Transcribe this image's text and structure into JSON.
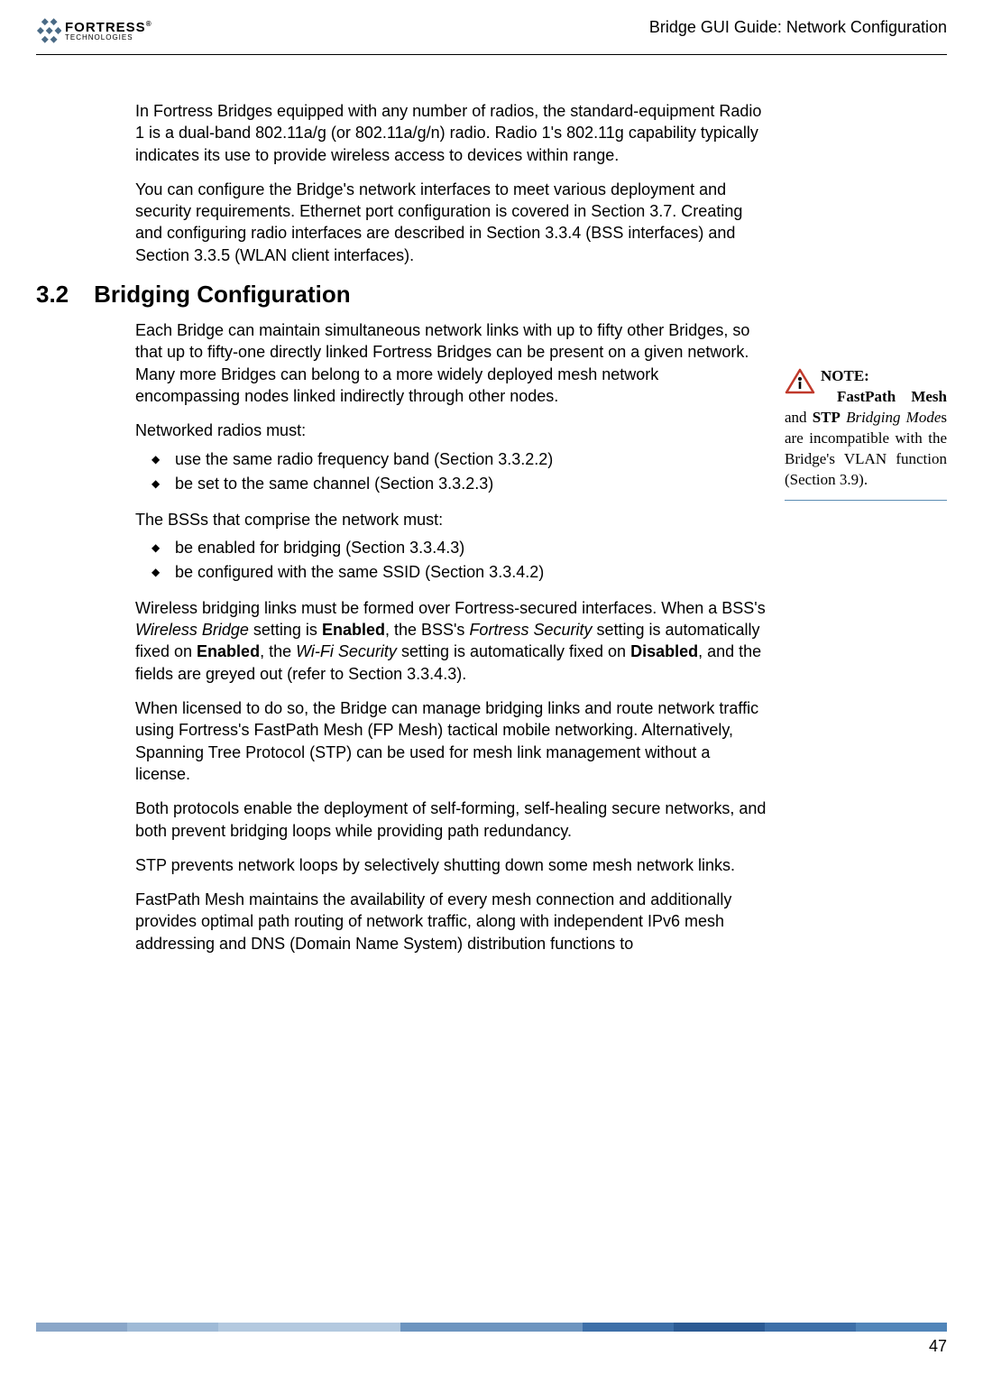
{
  "header": {
    "logo_main": "FORTRESS",
    "logo_sub": "TECHNOLOGIES",
    "title": "Bridge GUI Guide: Network Configuration"
  },
  "intro": {
    "p1": "In Fortress Bridges equipped with any number of radios, the standard-equipment Radio 1 is a dual-band 802.11a/g (or 802.11a/g/n) radio. Radio 1's 802.11g capability typically indicates its use to provide wireless access to devices within range.",
    "p2": "You can configure the Bridge's network interfaces to meet various deployment and security requirements. Ethernet port configuration is covered in Section 3.7. Creating and configuring radio interfaces are described in Section 3.3.4 (BSS interfaces) and Section 3.3.5 (WLAN client interfaces)."
  },
  "section": {
    "num": "3.2",
    "title": "Bridging Configuration",
    "p1": "Each Bridge can maintain simultaneous network links with up to fifty other Bridges, so that up to fifty-one directly linked Fortress Bridges can be present on a given network. Many more Bridges can belong to a more widely deployed mesh network encompassing nodes linked indirectly through other nodes.",
    "p2": "Networked radios must:",
    "bullets1": [
      "use the same radio frequency band (Section 3.3.2.2)",
      "be set to the same channel (Section 3.3.2.3)"
    ],
    "p3": "The BSSs that comprise the network must:",
    "bullets2": [
      "be enabled for bridging (Section 3.3.4.3)",
      "be configured with the same SSID (Section 3.3.4.2)"
    ],
    "p4_a": "Wireless bridging links must be formed over Fortress-secured interfaces. When a BSS's ",
    "p4_i1": "Wireless Bridge",
    "p4_b": " setting is ",
    "p4_b1": "Enabled",
    "p4_c": ", the BSS's ",
    "p4_i2": "Fortress Security",
    "p4_d": " setting is automatically fixed on ",
    "p4_b2": "Enabled",
    "p4_e": ", the ",
    "p4_i3": "Wi-Fi Security",
    "p4_f": " setting is automatically fixed on ",
    "p4_b3": "Disabled",
    "p4_g": ", and the fields are greyed out (refer to Section 3.3.4.3).",
    "p5": "When licensed to do so, the Bridge can manage bridging links and route network traffic using Fortress's FastPath Mesh (FP Mesh) tactical mobile networking. Alternatively, Spanning Tree Protocol (STP) can be used for mesh link management without a license.",
    "p6": "Both protocols enable the deployment of self-forming, self-healing secure networks, and both prevent bridging loops while providing path redundancy.",
    "p7": "STP prevents network loops by selectively shutting down some mesh network links.",
    "p8": "FastPath Mesh maintains the availability of every mesh connection and additionally provides optimal path routing of network traffic, along with independent IPv6 mesh addressing and DNS (Domain Name System) distribution functions to"
  },
  "note": {
    "label": "NOTE:",
    "b1": "FastPath Mesh",
    "mid": " and ",
    "b2": "STP",
    "i1": " Bridging Mode",
    "rest": "s are incompatible with the Bridge's VLAN function (Section 3.9)."
  },
  "footer": {
    "page": "47"
  },
  "colors": {
    "bar": [
      "#8aa6c8",
      "#9fbad6",
      "#b3c9df",
      "#b3c9df",
      "#6c94bf",
      "#6c94bf",
      "#3d6fa8",
      "#2b5a93",
      "#3d6fa8",
      "#5085b9"
    ]
  }
}
